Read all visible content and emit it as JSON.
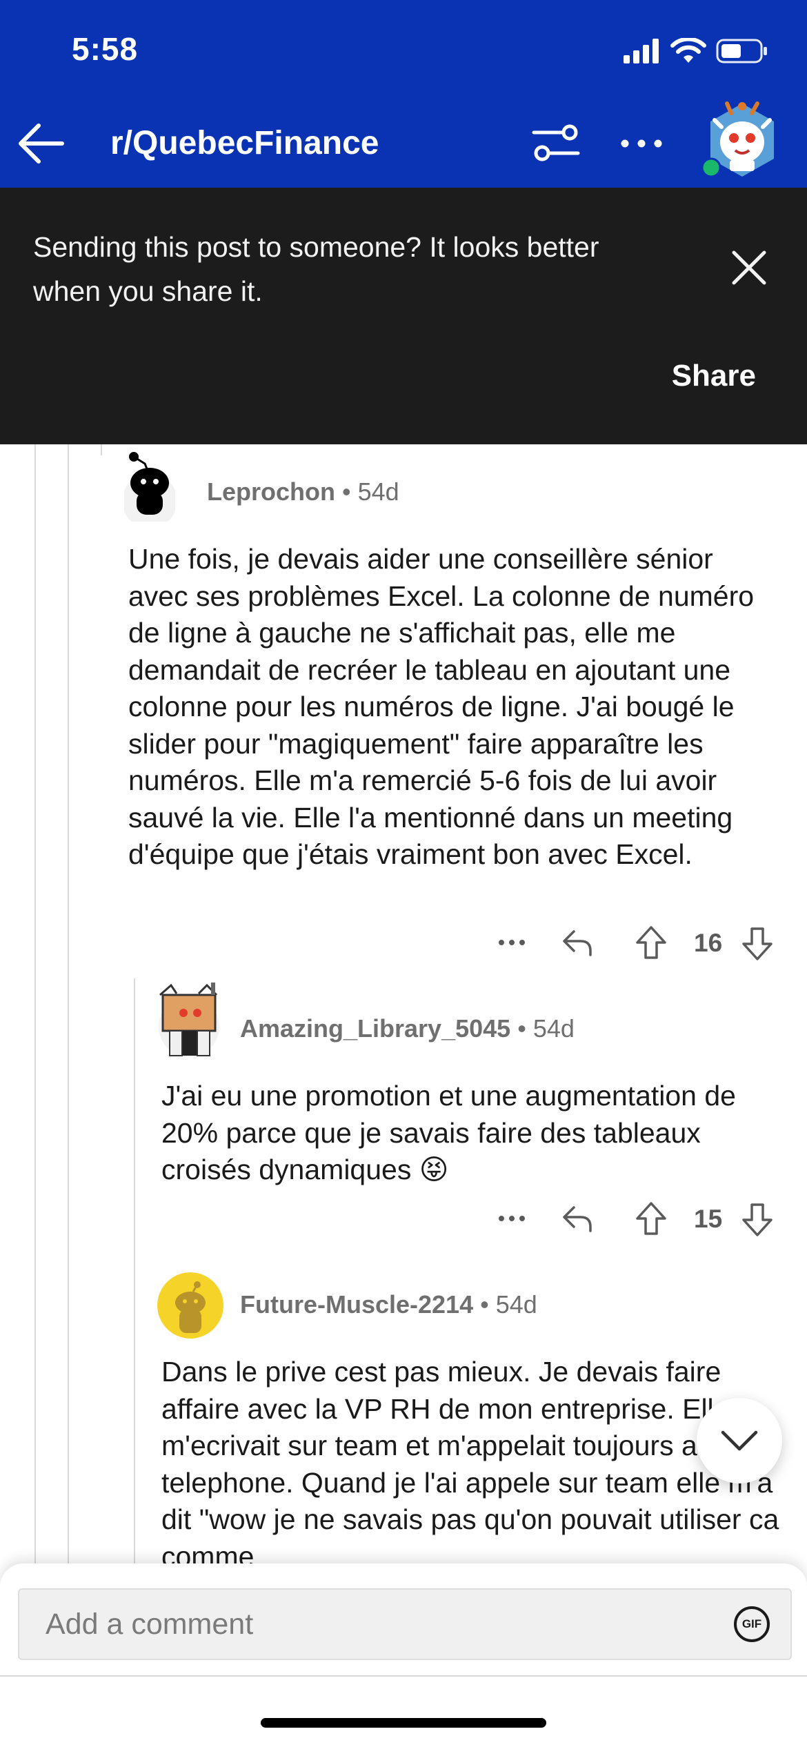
{
  "status_bar": {
    "time": "5:58"
  },
  "header": {
    "subreddit": "r/QuebecFinance"
  },
  "share_banner": {
    "message": "Sending this post to someone? It looks better when you share it.",
    "share_label": "Share"
  },
  "comments": [
    {
      "author": "Leprochon",
      "age": "54d",
      "body": "Une fois, je devais aider une conseillère sénior avec ses problèmes Excel. La colonne de numéro de ligne à gauche ne s'affichait pas, elle me demandait de recréer le tableau en ajoutant une colonne pour les numéros de ligne. J'ai bougé le slider pour \"magiquement\" faire apparaître les numéros. Elle m'a remercié 5-6 fois de lui avoir sauvé la vie. Elle l'a mentionné dans un meeting d'équipe que j'étais vraiment bon avec Excel.",
      "votes": "16"
    },
    {
      "author": "Amazing_Library_5045",
      "age": "54d",
      "body": "J'ai eu une promotion et une augmentation de 20% parce que je savais faire des tableaux croisés dynamiques 😝",
      "votes": "15"
    },
    {
      "author": "Future-Muscle-2214",
      "age": "54d",
      "body": "Dans le prive cest pas mieux. Je devais faire affaire avec la VP RH de mon entreprise. Elle m'ecrivait sur team et m'appelait toujours au telephone. Quand je l'ai appele sur team elle m'a dit \"wow je ne savais pas qu'on pouvait utiliser ca comme"
    }
  ],
  "comment_bar": {
    "placeholder": "Add a comment",
    "gif_label": "GIF"
  },
  "colors": {
    "header_bg": "#0a33b3",
    "banner_bg": "#1c1c1c",
    "snoo_yellow": "#f5d328"
  }
}
